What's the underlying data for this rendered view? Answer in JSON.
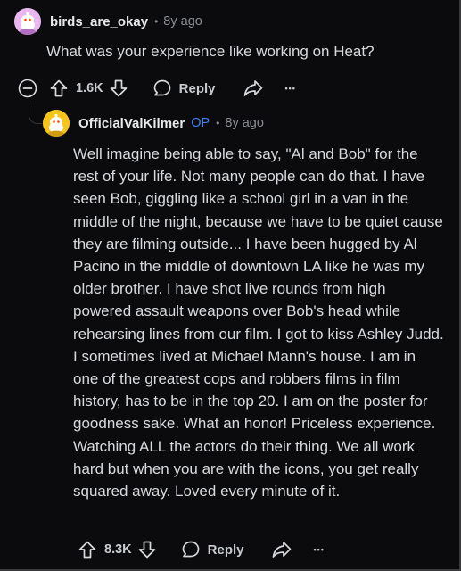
{
  "parent_comment": {
    "username": "birds_are_okay",
    "age": "8y ago",
    "body": "What was your experience like working on Heat?",
    "score": "1.6K",
    "reply_label": "Reply",
    "more_label": "•••"
  },
  "reply_comment": {
    "username": "OfficialValKilmer",
    "op_badge": "OP",
    "age": "8y ago",
    "body": "Well imagine being able to say, \"Al and Bob\" for the rest of your life. Not many people can do that. I have seen Bob, giggling like a school girl in a van in the middle of the night, because we have to be quiet cause they are filming outside... I have been hugged by Al Pacino in the middle of downtown LA like he was my older brother. I have shot live rounds from high powered assault weapons over Bob's head while rehearsing lines from our film. I got to kiss Ashley Judd. I sometimes lived at Michael Mann's house. I am in one of the greatest cops and robbers films in film history, has to be in the top 20. I am on the poster for goodness sake. What an honor! Priceless experience. Watching ALL the actors do their thing. We all work hard but when you are with the icons, you get really squared away. Loved every minute of it.",
    "score": "8.3K",
    "reply_label": "Reply",
    "more_label": "•••"
  },
  "icons": {
    "collapse": "collapse-minus-icon",
    "upvote": "upvote-arrow-icon",
    "downvote": "downvote-arrow-icon",
    "reply": "speech-bubble-icon",
    "share": "share-arrow-icon",
    "avatar1": "snoo-avatar-pink",
    "avatar2": "snoo-avatar-yellow"
  },
  "colors": {
    "background": "#0b0b0d",
    "text": "#d7dadc",
    "muted": "#8b8f94",
    "op_badge": "#3b82f6",
    "avatar1_bg": "#e9b6f0",
    "avatar2_bg": "#f6c51b"
  }
}
